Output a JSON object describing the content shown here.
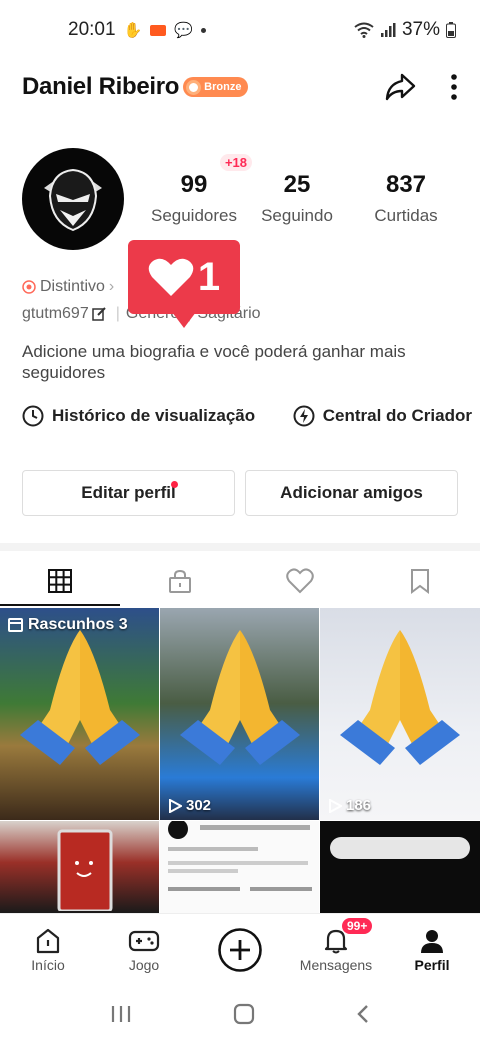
{
  "status": {
    "time": "20:01",
    "battery": "37%"
  },
  "profile": {
    "name": "Daniel Ribeiro",
    "badge": "Bronze",
    "followers": "99",
    "followers_delta": "+18",
    "followers_label": "Seguidores",
    "following": "25",
    "following_label": "Seguindo",
    "likes": "837",
    "likes_label": "Curtidas",
    "distintivo": "Distintivo",
    "handle": "gtutm697",
    "gender": "Gênero",
    "zodiac": "Sagitário",
    "bio": "Adicione uma biografia e você poderá ganhar mais seguidores"
  },
  "like_popup": {
    "count": "1"
  },
  "links": {
    "history": "Histórico de visualização",
    "creator": "Central do Criador"
  },
  "buttons": {
    "edit": "Editar perfil",
    "add_friends": "Adicionar amigos"
  },
  "videos": {
    "drafts": "Rascunhos 3",
    "views_2": "302",
    "views_3": "186"
  },
  "nav": {
    "home": "Início",
    "game": "Jogo",
    "messages": "Mensagens",
    "messages_badge": "99+",
    "profile": "Perfil"
  },
  "colors": {
    "accent": "#ff2a55",
    "badge": "#ff8a50",
    "like_popup": "#ec3a4a"
  }
}
